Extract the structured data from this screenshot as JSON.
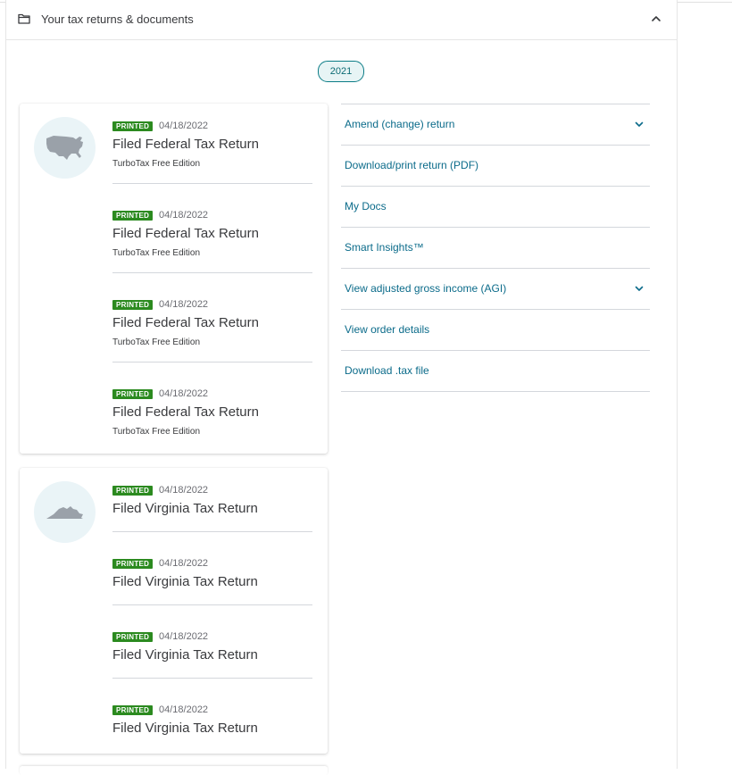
{
  "section": {
    "title": "Your tax returns & documents",
    "year": "2021"
  },
  "federal": {
    "entries": [
      {
        "badge": "PRINTED",
        "date": "04/18/2022",
        "title": "Filed Federal Tax Return",
        "subtitle": "TurboTax Free Edition"
      },
      {
        "badge": "PRINTED",
        "date": "04/18/2022",
        "title": "Filed Federal Tax Return",
        "subtitle": "TurboTax Free Edition"
      },
      {
        "badge": "PRINTED",
        "date": "04/18/2022",
        "title": "Filed Federal Tax Return",
        "subtitle": "TurboTax Free Edition"
      },
      {
        "badge": "PRINTED",
        "date": "04/18/2022",
        "title": "Filed Federal Tax Return",
        "subtitle": "TurboTax Free Edition"
      }
    ]
  },
  "virginia": {
    "entries": [
      {
        "badge": "PRINTED",
        "date": "04/18/2022",
        "title": "Filed Virginia Tax Return"
      },
      {
        "badge": "PRINTED",
        "date": "04/18/2022",
        "title": "Filed Virginia Tax Return"
      },
      {
        "badge": "PRINTED",
        "date": "04/18/2022",
        "title": "Filed Virginia Tax Return"
      },
      {
        "badge": "PRINTED",
        "date": "04/18/2022",
        "title": "Filed Virginia Tax Return"
      }
    ]
  },
  "actions": [
    {
      "label": "Amend (change) return",
      "expandable": true
    },
    {
      "label": "Download/print return (PDF)",
      "expandable": false
    },
    {
      "label": "My Docs",
      "expandable": false
    },
    {
      "label": "Smart Insights™",
      "expandable": false
    },
    {
      "label": "View adjusted gross income (AGI)",
      "expandable": true
    },
    {
      "label": "View order details",
      "expandable": false
    },
    {
      "label": "Download .tax file",
      "expandable": false
    }
  ],
  "icons": {
    "folder": "folder-icon",
    "collapse": "chevron-up-icon",
    "expand": "chevron-down-icon",
    "federal": "usa-map-icon",
    "state": "virginia-map-icon"
  },
  "colors": {
    "accent": "#0b6b8a",
    "badge": "#2b8a1f",
    "pill_border": "#0b7c86",
    "pill_bg": "#e7f4f5",
    "map": "#9aa1a9",
    "circle": "#eaf4f7"
  }
}
